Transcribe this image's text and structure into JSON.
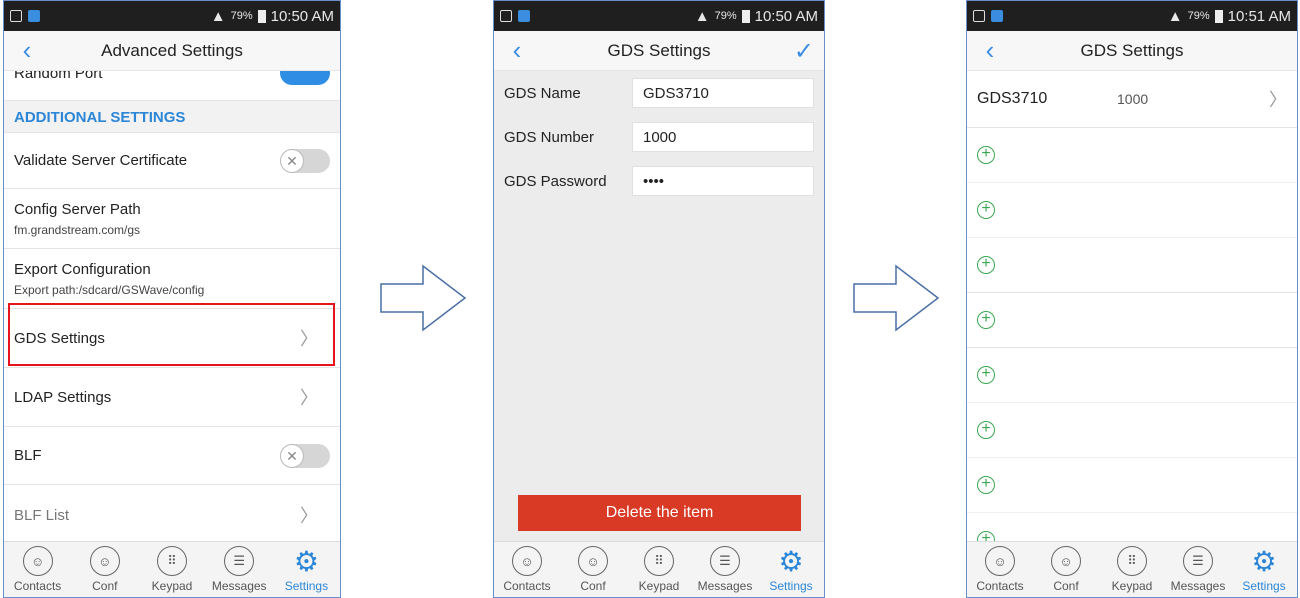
{
  "panel1": {
    "status": {
      "percent": "79%",
      "time": "10:50 AM"
    },
    "title": "Advanced Settings",
    "partial_row": "Random Port",
    "section_header": "ADDITIONAL SETTINGS",
    "rows": [
      {
        "label": "Validate Server Certificate"
      },
      {
        "label": "Config Server Path",
        "sub": "fm.grandstream.com/gs"
      },
      {
        "label": "Export Configuration",
        "sub": "Export path:/sdcard/GSWave/config"
      },
      {
        "label": "GDS Settings"
      },
      {
        "label": "LDAP Settings"
      },
      {
        "label": "BLF"
      },
      {
        "label": "BLF List"
      }
    ]
  },
  "panel2": {
    "status": {
      "percent": "79%",
      "time": "10:50 AM"
    },
    "title": "GDS Settings",
    "fields": [
      {
        "label": "GDS Name",
        "value": "GDS3710"
      },
      {
        "label": "GDS Number",
        "value": "1000"
      },
      {
        "label": "GDS Password",
        "value": "••••"
      }
    ],
    "delete_label": "Delete the item"
  },
  "panel3": {
    "status": {
      "percent": "79%",
      "time": "10:51 AM"
    },
    "title": "GDS Settings",
    "entry": {
      "name": "GDS3710",
      "number": "1000"
    }
  },
  "nav": {
    "contacts": "Contacts",
    "conf": "Conf",
    "keypad": "Keypad",
    "messages": "Messages",
    "settings": "Settings"
  },
  "colors": {
    "accent": "#2b86d8",
    "delete": "#d83a25",
    "highlight": "#e8141c",
    "add": "#3aa852"
  },
  "icons": [
    "back-icon",
    "check-icon",
    "chevron-right-icon",
    "toggle-off-icon",
    "plus-circle-icon",
    "contacts-icon",
    "conf-icon",
    "keypad-icon",
    "messages-icon",
    "settings-gear-icon",
    "arrow-right-icon"
  ]
}
